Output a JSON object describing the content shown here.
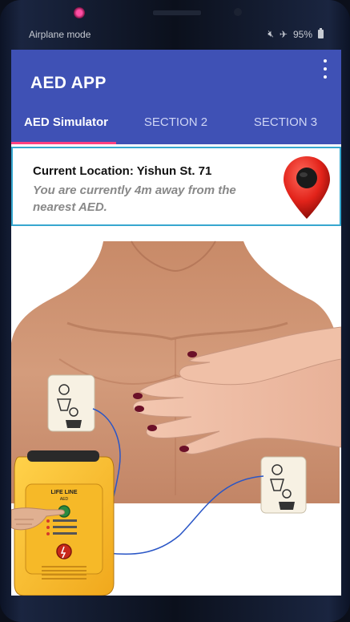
{
  "status_bar": {
    "left_text": "Airplane mode",
    "battery": "95%",
    "icons": [
      "mute-icon",
      "airplane-icon",
      "battery-icon"
    ]
  },
  "app": {
    "title": "AED APP",
    "menu_icon": "overflow-menu-icon",
    "accent_color": "#3f51b5",
    "indicator_color": "#ff4081"
  },
  "tabs": [
    {
      "label": "AED Simulator",
      "active": true
    },
    {
      "label": "SECTION 2",
      "active": false
    },
    {
      "label": "SECTION 3",
      "active": false
    }
  ],
  "location": {
    "title": "Current Location: Yishun St. 71",
    "subtitle": "You are currently 4m away from the nearest AED.",
    "icon": "map-pin-icon"
  },
  "simulator": {
    "device_brand": "LIFE LINE",
    "device_model": "AED"
  }
}
